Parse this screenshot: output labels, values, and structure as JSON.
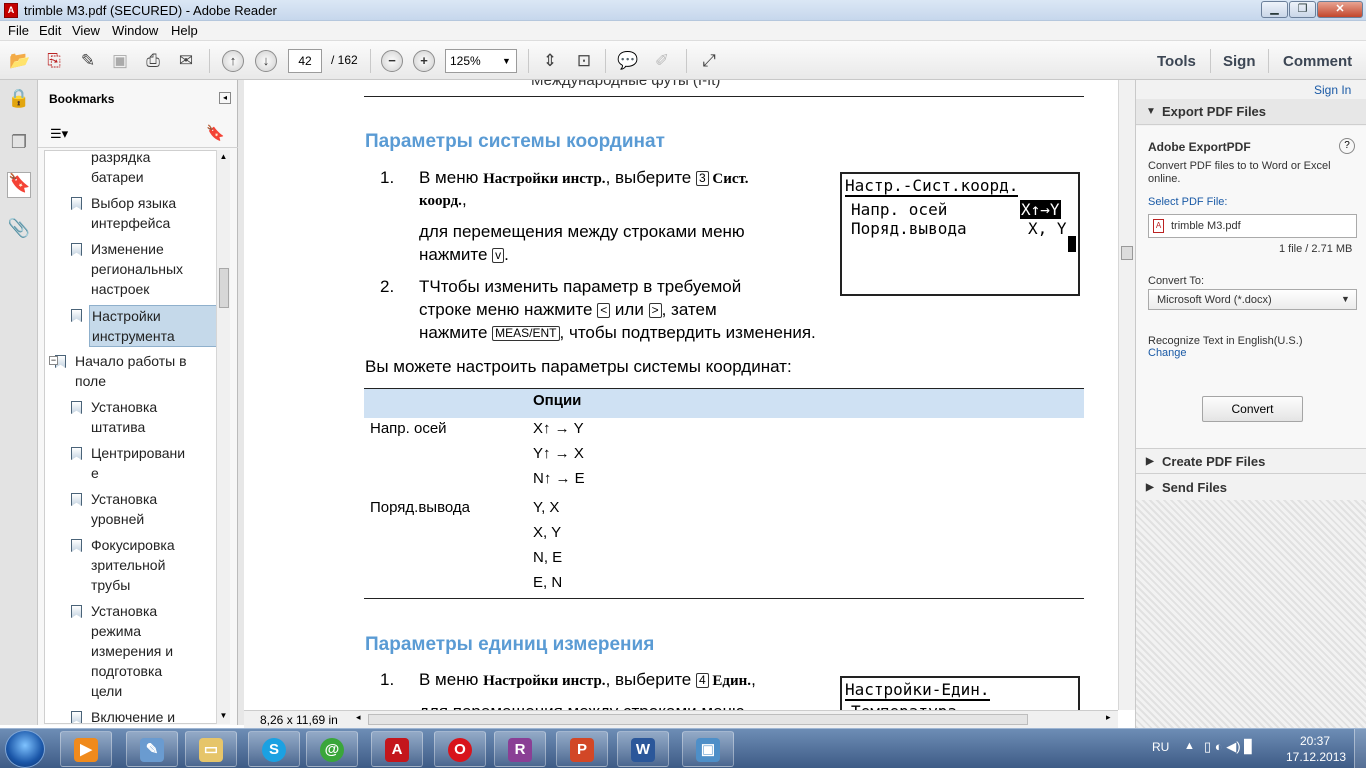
{
  "window": {
    "title": "trimble M3.pdf (SECURED) - Adobe Reader",
    "min": "▁",
    "max": "❐",
    "close": "✕"
  },
  "menu": {
    "file": "File",
    "edit": "Edit",
    "view": "View",
    "window": "Window",
    "help": "Help"
  },
  "toolbar": {
    "page_current": "42",
    "page_total": "/ 162",
    "zoom": "125%",
    "tools": "Tools",
    "sign": "Sign",
    "comment": "Comment"
  },
  "bookmarks": {
    "title": "Bookmarks",
    "items": [
      {
        "label_lines": [
          "разрядка",
          "батареи"
        ]
      },
      {
        "label_lines": [
          "Выбор языка",
          "интерфейса"
        ]
      },
      {
        "label_lines": [
          "Изменение",
          "региональных",
          "настроек"
        ]
      },
      {
        "label_lines": [
          "Настройки",
          "инструмента"
        ]
      },
      {
        "label_lines": [
          "Начало работы в",
          "поле"
        ]
      },
      {
        "label_lines": [
          "Установка",
          "штатива"
        ]
      },
      {
        "label_lines": [
          "Центрировани",
          "е"
        ]
      },
      {
        "label_lines": [
          "Установка",
          "уровней"
        ]
      },
      {
        "label_lines": [
          "Фокусировка",
          "зрительной",
          "трубы"
        ]
      },
      {
        "label_lines": [
          " Установка",
          "режима",
          "измерения и",
          "подготовка",
          "цели"
        ]
      },
      {
        "label_lines": [
          "Включение и"
        ]
      }
    ]
  },
  "document": {
    "top_cut_text": "Международные футы (I-ft)",
    "section1": {
      "heading": "Параметры системы координат",
      "step1_num": "1.",
      "step1_a": "В меню ",
      "step1_b": "Настройки инстр.",
      "step1_c": ", выберите ",
      "step1_key": "3",
      "step1_d": " Сист.",
      "step1_e": "коорд.",
      "step1_f": ",",
      "step1_line3": "для перемещения между строками меню",
      "step1_line4": "нажмите ",
      "step1_key2": "v",
      "step1_line4_end": ".",
      "step2_num": "2.",
      "step2_line1": "ТЧтобы изменить параметр в требуемой",
      "step2_line2a": "строке меню нажмите ",
      "step2_key_left": "<",
      "step2_line2b": " или ",
      "step2_key_right": ">",
      "step2_line2c": ", затем",
      "step2_line3a": "нажмите ",
      "step2_key_enter": "MEAS/ENT",
      "step2_line3b": ", чтобы подтвердить изменения.",
      "screen": {
        "title": "Настр.-Сист.коорд.",
        "row1_label": "Напр. осей",
        "row1_value": "X↑→Y",
        "row2_label": "Поряд.вывода",
        "row2_value": "X, Y"
      },
      "intro": "Вы можете настроить параметры системы координат:",
      "table_header": "Опции",
      "table": [
        {
          "param": "Напр. осей",
          "options": [
            "X↑ → Y",
            "Y↑ → X",
            "N↑ → E"
          ]
        },
        {
          "param": "Поряд.вывода",
          "options": [
            "Y, X",
            "X, Y",
            "N, E",
            "E, N"
          ]
        }
      ]
    },
    "section2": {
      "heading": "Параметры единиц измерения",
      "step1_num": "1.",
      "step1_a": "В меню ",
      "step1_b": "Настройки инстр.",
      "step1_c": ", выберите ",
      "step1_key": "4",
      "step1_d": " Един.",
      "step1_e": ",",
      "step1_line2": "для перемещения между строками меню",
      "screen": {
        "title": "Настройки-Един.",
        "row1_label": "Температура"
      }
    }
  },
  "statusbar": {
    "page_size": "8,26 x 11,69 in"
  },
  "rightpanel": {
    "signin": "Sign In",
    "export_title": "Export PDF Files",
    "product": "Adobe ExportPDF",
    "desc_line1": "Convert PDF files to to Word or Excel",
    "desc_line2": "online.",
    "select_label": "Select PDF File:",
    "file_name": "trimble M3.pdf",
    "file_info": "1 file / 2.71 MB",
    "convert_to_label": "Convert To:",
    "convert_to_value": "Microsoft Word (*.docx)",
    "recognize": "Recognize Text in English(U.S.)",
    "change": "Change",
    "convert_button": "Convert",
    "create_title": "Create PDF Files",
    "send_title": "Send Files"
  },
  "taskbar": {
    "lang": "RU",
    "time": "20:37",
    "date": "17.12.2013"
  }
}
